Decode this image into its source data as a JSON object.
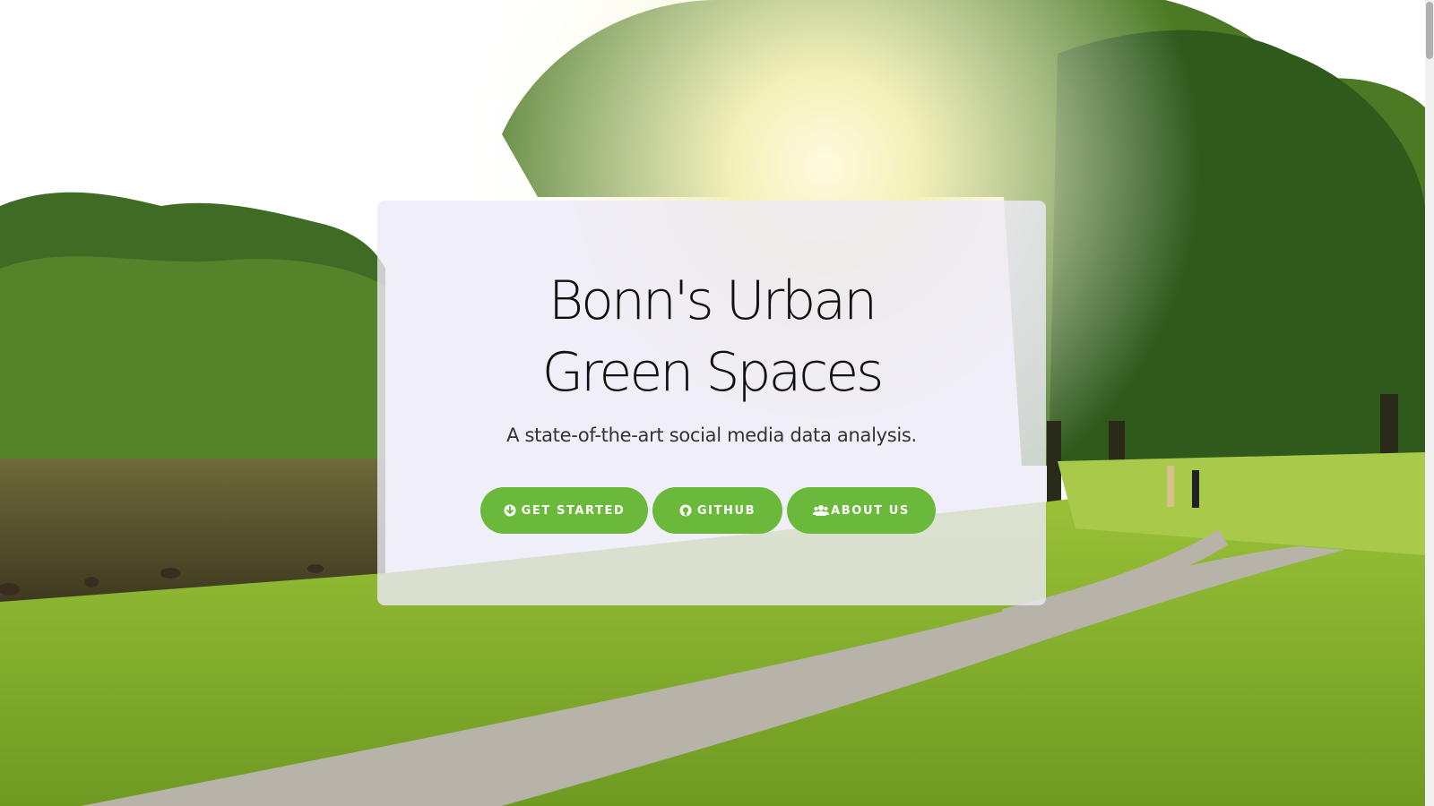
{
  "hero": {
    "title": "Bonn's Urban Green Spaces",
    "subtitle": "A state-of-the-art social media data analysis."
  },
  "buttons": [
    {
      "label": "GET STARTED",
      "icon": "arrow-circle-down-icon"
    },
    {
      "label": "GITHUB",
      "icon": "github-icon"
    },
    {
      "label": "ABOUT US",
      "icon": "users-icon"
    }
  ],
  "colors": {
    "button_green": "#6ab93a",
    "card_overlay": "rgba(236,234,246,0.80)"
  }
}
